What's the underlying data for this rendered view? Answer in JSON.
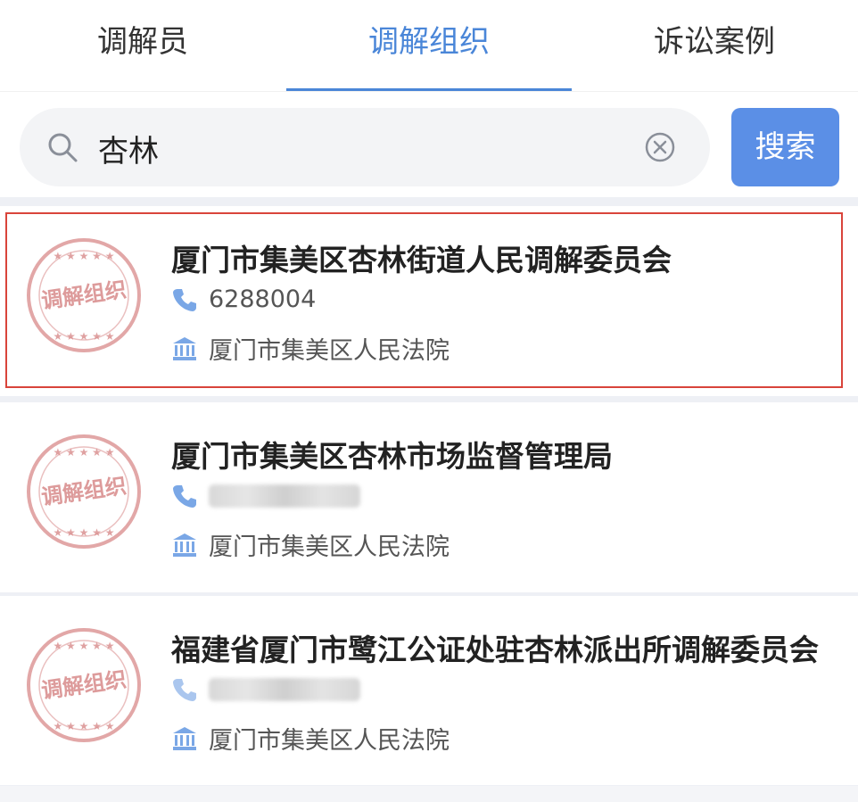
{
  "tabs": [
    {
      "label": "调解员"
    },
    {
      "label": "调解组织"
    },
    {
      "label": "诉讼案例"
    }
  ],
  "active_tab": "调解组织",
  "search": {
    "value": "杏林",
    "button_label": "搜索"
  },
  "stamp_text": "调解组织",
  "results": [
    {
      "name": "厦门市集美区杏林街道人民调解委员会",
      "phone": "6288004",
      "court": "厦门市集美区人民法院",
      "selected": true
    },
    {
      "name": "厦门市集美区杏林市场监督管理局",
      "phone_obscured": true,
      "court": "厦门市集美区人民法院"
    },
    {
      "name": "福建省厦门市鹭江公证处驻杏林派出所调解委员会",
      "phone_obscured": true,
      "court": "厦门市集美区人民法院"
    }
  ],
  "colors": {
    "accent": "#4a86d8",
    "button": "#5b8fe6",
    "highlight_border": "#d9443b",
    "stamp": "#d88a8a"
  }
}
